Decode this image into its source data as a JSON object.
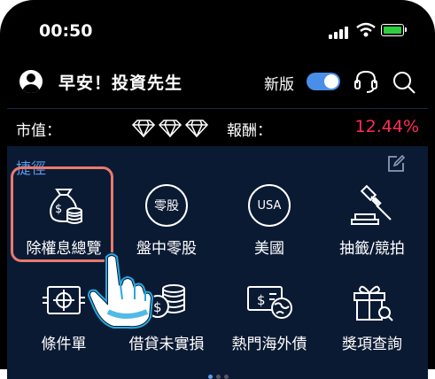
{
  "status_bar": {
    "time": "00:50"
  },
  "header": {
    "greeting": "早安！投資先生",
    "new_version_label": "新版",
    "new_version_toggle_on": true
  },
  "stats": {
    "market_value_label": "市值：",
    "return_label": "報酬：",
    "return_value": "12.44%",
    "return_color": "#ff2d55"
  },
  "shortcuts": {
    "title": "捷徑",
    "items": [
      {
        "label": "除權息總覽",
        "icon": "money-bag-coins-icon",
        "selected": true
      },
      {
        "label": "盤中零股",
        "icon": "odd-lot-stock-icon",
        "badge": "零股"
      },
      {
        "label": "美國",
        "icon": "usa-icon",
        "badge": "USA"
      },
      {
        "label": "抽籤/競拍",
        "icon": "gavel-icon"
      },
      {
        "label": "條件單",
        "icon": "conditional-order-icon"
      },
      {
        "label": "借貸未實損",
        "icon": "coin-stack-icon"
      },
      {
        "label": "熱門海外債",
        "icon": "overseas-bond-icon"
      },
      {
        "label": "獎項查詢",
        "icon": "gift-search-icon"
      }
    ]
  },
  "colors": {
    "accent": "#5d9be8",
    "background": "#0b1a33",
    "highlight_border": "#e97a6e"
  }
}
